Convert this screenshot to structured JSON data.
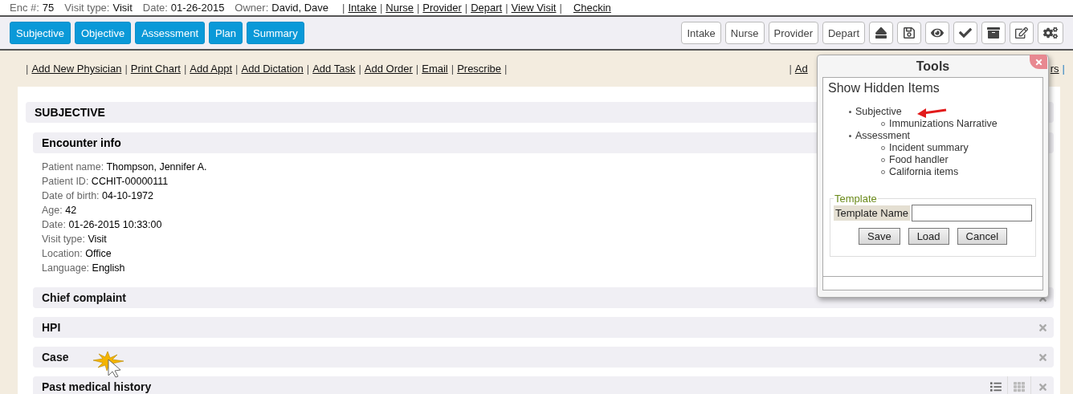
{
  "header": {
    "fields": [
      {
        "label": "Enc #:",
        "value": "75"
      },
      {
        "label": "Visit type:",
        "value": "Visit"
      },
      {
        "label": "Date:",
        "value": "01-26-2015"
      },
      {
        "label": "Owner:",
        "value": "David, Dave"
      }
    ],
    "links": [
      {
        "kind": "separator",
        "text": "|"
      },
      {
        "kind": "link",
        "text": "Intake"
      },
      {
        "kind": "separator",
        "text": "|"
      },
      {
        "kind": "link",
        "text": "Nurse"
      },
      {
        "kind": "separator",
        "text": "|"
      },
      {
        "kind": "link",
        "text": "Provider"
      },
      {
        "kind": "separator",
        "text": "|"
      },
      {
        "kind": "link",
        "text": "Depart"
      },
      {
        "kind": "separator",
        "text": "|"
      },
      {
        "kind": "link",
        "text": "View Visit"
      },
      {
        "kind": "separator",
        "text": "|"
      }
    ],
    "checkin": "Checkin"
  },
  "toolbar": {
    "section_buttons": [
      "Subjective",
      "Objective",
      "Assessment",
      "Plan",
      "Summary"
    ],
    "role_buttons": [
      "Intake",
      "Nurse",
      "Provider",
      "Depart"
    ]
  },
  "action_links": {
    "left": [
      {
        "kind": "separator",
        "text": "|"
      },
      {
        "kind": "link",
        "text": "Add New Physician"
      },
      {
        "kind": "separator",
        "text": "|"
      },
      {
        "kind": "link",
        "text": "Print Chart"
      },
      {
        "kind": "separator",
        "text": "|"
      },
      {
        "kind": "link",
        "text": "Add Appt"
      },
      {
        "kind": "separator",
        "text": "|"
      },
      {
        "kind": "link",
        "text": "Add Dictation"
      },
      {
        "kind": "separator",
        "text": "|"
      },
      {
        "kind": "link",
        "text": "Add Task"
      },
      {
        "kind": "separator",
        "text": "|"
      },
      {
        "kind": "link",
        "text": "Add Order"
      },
      {
        "kind": "separator",
        "text": "|"
      },
      {
        "kind": "link",
        "text": "Email"
      },
      {
        "kind": "separator",
        "text": "|"
      },
      {
        "kind": "link",
        "text": "Prescribe"
      },
      {
        "kind": "separator",
        "text": "|"
      }
    ],
    "right": [
      {
        "kind": "separator",
        "text": "|"
      },
      {
        "kind": "link",
        "text": "Ad"
      },
      {
        "kind": "link",
        "text": "rs"
      },
      {
        "kind": "separator",
        "text": "|"
      }
    ]
  },
  "section": {
    "title": "SUBJECTIVE",
    "items": [
      {
        "title": "Encounter info",
        "kind": "basic",
        "expanded": true,
        "fields": [
          {
            "label": "Patient name:",
            "value": "Thompson, Jennifer A."
          },
          {
            "label": "Patient ID:",
            "value": "CCHIT-00000111"
          },
          {
            "label": "Date of birth:",
            "value": "04-10-1972"
          },
          {
            "label": "Age:",
            "value": "42"
          },
          {
            "label": "Date:",
            "value": "01-26-2015 10:33:00"
          },
          {
            "label": "Visit type:",
            "value": "Visit"
          },
          {
            "label": "Location:",
            "value": "Office"
          },
          {
            "label": "Language:",
            "value": "English"
          }
        ]
      },
      {
        "title": "Chief complaint",
        "kind": "basic",
        "expanded": false,
        "removable": true
      },
      {
        "title": "HPI",
        "kind": "basic",
        "expanded": false,
        "removable": true
      },
      {
        "title": "Case",
        "kind": "basic",
        "expanded": false,
        "removable": true
      },
      {
        "title": "Past medical history",
        "kind": "views",
        "expanded": false,
        "removable": true
      }
    ]
  },
  "tools_popup": {
    "title": "Tools",
    "heading": "Show Hidden Items",
    "tree": [
      {
        "label": "Subjective",
        "children": [
          {
            "label": "Immunizations Narrative"
          }
        ]
      },
      {
        "label": "Assessment",
        "children": [
          {
            "label": "Incident summary"
          },
          {
            "label": "Food handler"
          },
          {
            "label": "California items"
          }
        ]
      }
    ],
    "template": {
      "legend": "Template",
      "field_label": "Template Name",
      "buttons": [
        "Save",
        "Load",
        "Cancel"
      ]
    }
  }
}
